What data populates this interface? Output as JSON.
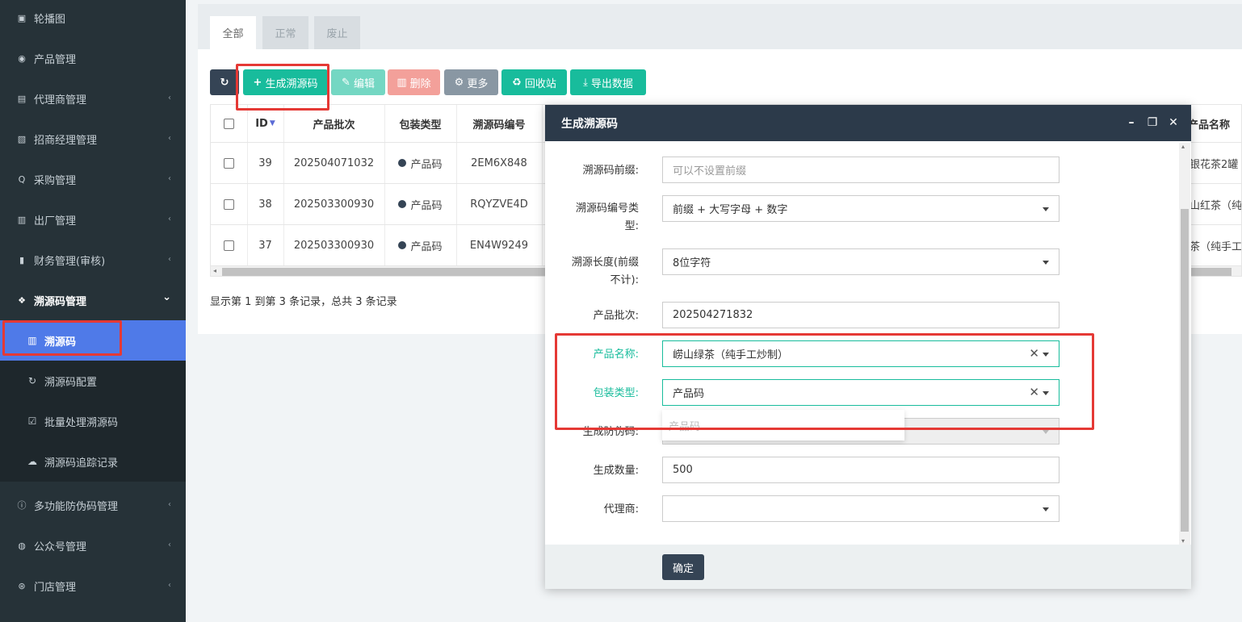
{
  "sidebar": {
    "items": [
      {
        "label": "轮播图",
        "icon": "image-icon",
        "glyph": "▣",
        "arrow": false
      },
      {
        "label": "产品管理",
        "icon": "globe-icon",
        "glyph": "◉",
        "arrow": false
      },
      {
        "label": "代理商管理",
        "icon": "id-card-icon",
        "glyph": "▤",
        "arrow": true
      },
      {
        "label": "招商经理管理",
        "icon": "contact-icon",
        "glyph": "▧",
        "arrow": true
      },
      {
        "label": "采购管理",
        "icon": "q-icon",
        "glyph": "Q",
        "arrow": true
      },
      {
        "label": "出厂管理",
        "icon": "bus-icon",
        "glyph": "▥",
        "arrow": true
      },
      {
        "label": "财务管理(审核)",
        "icon": "ledger-icon",
        "glyph": "▮",
        "arrow": true
      }
    ],
    "open_group": {
      "label": "溯源码管理",
      "icon": "cubes-icon",
      "glyph": "❖",
      "arrow": "⌄"
    },
    "sub_items": [
      {
        "label": "溯源码",
        "icon": "barcode-icon",
        "glyph": "▥",
        "active": true
      },
      {
        "label": "溯源码配置",
        "icon": "refresh-icon",
        "glyph": "↻",
        "active": false
      },
      {
        "label": "批量处理溯源码",
        "icon": "check-square-icon",
        "glyph": "☑",
        "active": false
      },
      {
        "label": "溯源码追踪记录",
        "icon": "cloud-icon",
        "glyph": "☁",
        "active": false
      }
    ],
    "items_after": [
      {
        "label": "多功能防伪码管理",
        "icon": "info-icon",
        "glyph": "ⓘ",
        "arrow": true
      },
      {
        "label": "公众号管理",
        "icon": "wechat-icon",
        "glyph": "◍",
        "arrow": true
      },
      {
        "label": "门店管理",
        "icon": "store-icon",
        "glyph": "⊛",
        "arrow": true
      }
    ]
  },
  "tabs": [
    "全部",
    "正常",
    "废止"
  ],
  "toolbar": {
    "refresh_glyph": "↻",
    "generate": "生成溯源码",
    "edit": "编辑",
    "delete": "删除",
    "more": "更多",
    "recycle": "回收站",
    "export": "导出数据"
  },
  "table": {
    "headers": [
      "ID",
      "产品批次",
      "包装类型",
      "溯源码编号",
      "产品名称"
    ],
    "rows": [
      {
        "id": "39",
        "batch": "202504071032",
        "pack": "产品码",
        "code": "2EM6X848",
        "name": "银花茶2罐"
      },
      {
        "id": "38",
        "batch": "202503300930",
        "pack": "产品码",
        "code": "RQYZVE4D",
        "name": "山红茶（纯"
      },
      {
        "id": "37",
        "batch": "202503300930",
        "pack": "产品码",
        "code": "EN4W9249",
        "name": "茶（纯手工"
      }
    ],
    "footer": "显示第 1 到第 3 条记录，总共 3 条记录"
  },
  "dialog": {
    "title": "生成溯源码",
    "fields": {
      "prefix_label": "溯源码前缀:",
      "prefix_placeholder": "可以不设置前缀",
      "type_label_1": "溯源码编号类",
      "type_label_2": "型:",
      "type_value": "前缀 + 大写字母 + 数字",
      "length_label_1": "溯源长度(前缀",
      "length_label_2": "不计):",
      "length_value": "8位字符",
      "batch_label": "产品批次:",
      "batch_value": "202504271832",
      "product_label": "产品名称:",
      "product_value": "崂山绿茶（纯手工炒制）",
      "pack_label": "包装类型:",
      "pack_value": "产品码",
      "pack_dropdown_option": "产品码",
      "anticounterfeit_label": "生成防伪码:",
      "quantity_label": "生成数量:",
      "quantity_value": "500",
      "agent_label": "代理商:",
      "agent_value": ""
    },
    "ok": "确定"
  },
  "colors": {
    "sidebar_bg": "#263238",
    "active_blue": "#4f7ae8",
    "green": "#18bc9c",
    "dark": "#354455",
    "highlight_red": "#e53935"
  }
}
